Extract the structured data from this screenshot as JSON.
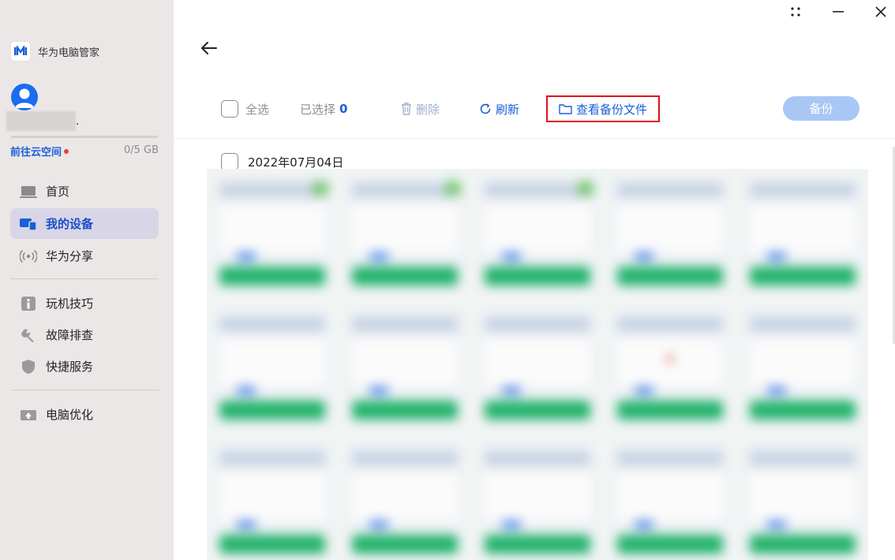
{
  "app": {
    "title": "华为电脑管家"
  },
  "account": {
    "display_name_suffix": ".",
    "cloud_link_label": "前往云空间",
    "storage_text": "0/5 GB",
    "storage_used_fraction": 0
  },
  "nav": {
    "primary": [
      {
        "label": "首页",
        "icon": "laptop-icon"
      },
      {
        "label": "我的设备",
        "icon": "devices-icon",
        "active": true
      },
      {
        "label": "华为分享",
        "icon": "share-signal-icon"
      }
    ],
    "secondary": [
      {
        "label": "玩机技巧",
        "icon": "tips-icon"
      },
      {
        "label": "故障排查",
        "icon": "wrench-icon"
      },
      {
        "label": "快捷服务",
        "icon": "shield-icon"
      }
    ],
    "tertiary": [
      {
        "label": "电脑优化",
        "icon": "optimize-icon"
      }
    ]
  },
  "window_controls": [
    "grid-icon",
    "minimize-icon",
    "close-icon"
  ],
  "toolbar": {
    "select_all_label": "全选",
    "selected_label": "已选择",
    "selected_count": "0",
    "delete_label": "删除",
    "refresh_label": "刷新",
    "view_backup_label": "查看备份文件",
    "backup_label": "备份"
  },
  "gallery": {
    "group_date": "2022年07月04日",
    "thumbnail_count": 15
  },
  "colors": {
    "accent": "#1a5fd8",
    "sidebar_bg": "#ebe7e7",
    "highlight_border": "#e0101a",
    "backup_button": "#a8c7f5"
  }
}
